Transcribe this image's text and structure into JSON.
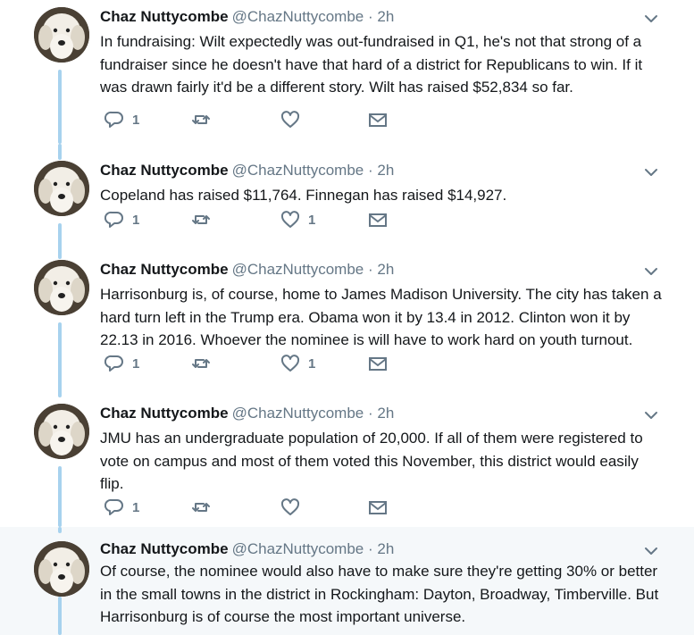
{
  "tweets": [
    {
      "name": "Chaz Nuttycombe",
      "handle": "@ChazNuttycombe",
      "time": "2h",
      "text": "In fundraising: Wilt expectedly was out-fundraised in Q1, he's not that strong of a fundraiser since he doesn't have that hard of a district for Republicans to win. If it was drawn fairly it'd be a different story. Wilt has raised $52,834 so far.",
      "replies": "1",
      "retweets": "",
      "likes": ""
    },
    {
      "name": "Chaz Nuttycombe",
      "handle": "@ChazNuttycombe",
      "time": "2h",
      "text": "Copeland has raised $11,764. Finnegan has raised $14,927.",
      "replies": "1",
      "retweets": "",
      "likes": "1"
    },
    {
      "name": "Chaz Nuttycombe",
      "handle": "@ChazNuttycombe",
      "time": "2h",
      "text": "Harrisonburg is, of course, home to James Madison University. The city has taken a hard turn left in the Trump era. Obama won it by 13.4 in 2012. Clinton won it by 22.13 in 2016. Whoever the nominee is will have to work hard on youth turnout.",
      "replies": "1",
      "retweets": "",
      "likes": "1"
    },
    {
      "name": "Chaz Nuttycombe",
      "handle": "@ChazNuttycombe",
      "time": "2h",
      "text": "JMU has an undergraduate population of 20,000. If all of them were registered to vote on campus and most of them voted this November, this district would easily flip.",
      "replies": "1",
      "retweets": "",
      "likes": ""
    },
    {
      "name": "Chaz Nuttycombe",
      "handle": "@ChazNuttycombe",
      "time": "2h",
      "text": "Of course, the nominee would also have to make sure they're getting 30% or better in the small towns in the district in Rockingham: Dayton, Broadway, Timberville. But Harrisonburg is of course the most important universe.",
      "replies": "",
      "retweets": "",
      "likes": ""
    }
  ],
  "separator": "·",
  "icons": {
    "reply": "reply-icon",
    "retweet": "retweet-icon",
    "like": "heart-icon",
    "dm": "envelope-icon",
    "caret": "chevron-down-icon"
  },
  "colors": {
    "thread_line": "#a7d2ee",
    "icon_gray": "#657786",
    "highlight_bg": "#f5f8fa"
  }
}
